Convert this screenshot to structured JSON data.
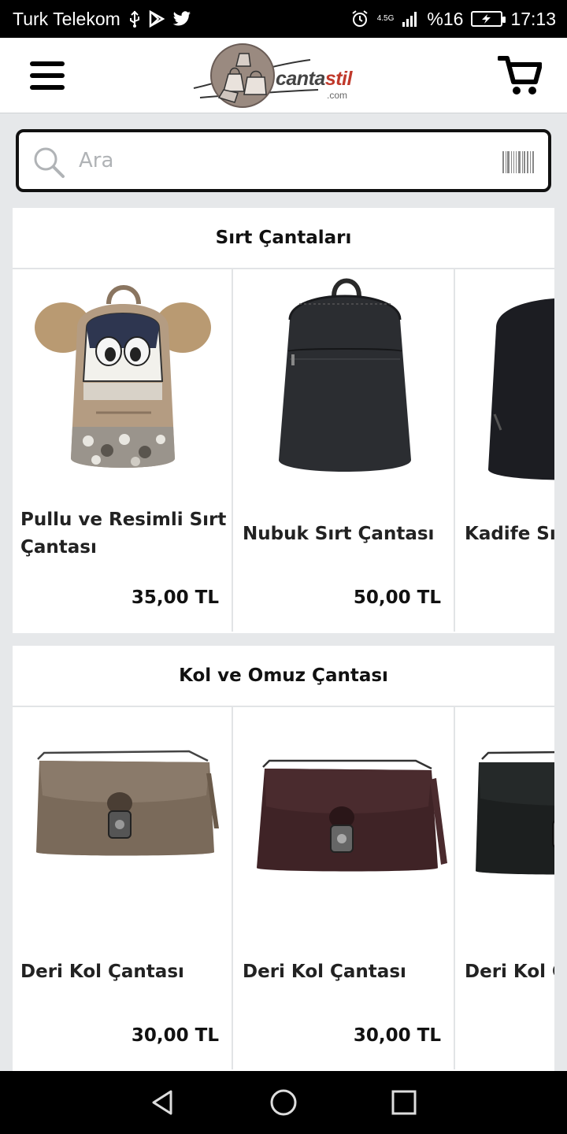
{
  "status_bar": {
    "carrier": "Turk Telekom",
    "network": "4.5G",
    "battery": "%16",
    "time": "17:13"
  },
  "header": {
    "logo_main": "canta",
    "logo_accent": "stil",
    "logo_sub": ".com"
  },
  "search": {
    "placeholder": "Ara",
    "value": ""
  },
  "sections": [
    {
      "title": "Sırt Çantaları",
      "products": [
        {
          "name": "Pullu ve Resimli Sırt Çantası",
          "price": "35,00 TL",
          "image": "backpack-beige-pompom"
        },
        {
          "name": "Nubuk Sırt Çantası",
          "price": "50,00 TL",
          "image": "backpack-black-nubuck"
        },
        {
          "name": "Kadife Sırt Çantası",
          "price": "",
          "image": "backpack-black-velvet"
        }
      ]
    },
    {
      "title": "Kol ve Omuz Çantası",
      "products": [
        {
          "name": "Deri Kol Çantası",
          "price": "30,00 TL",
          "image": "clutch-bronze"
        },
        {
          "name": "Deri Kol Çantası",
          "price": "30,00 TL",
          "image": "clutch-burgundy"
        },
        {
          "name": "Deri Kol Çantası",
          "price": "",
          "image": "clutch-black"
        }
      ]
    }
  ],
  "colors": {
    "bronze": "#7a6a5a",
    "burgundy": "#3f2326",
    "black": "#1c1d20",
    "beige": "#b49c82"
  },
  "nav": {
    "back": "back-icon",
    "home": "home-icon",
    "recents": "recents-icon"
  }
}
